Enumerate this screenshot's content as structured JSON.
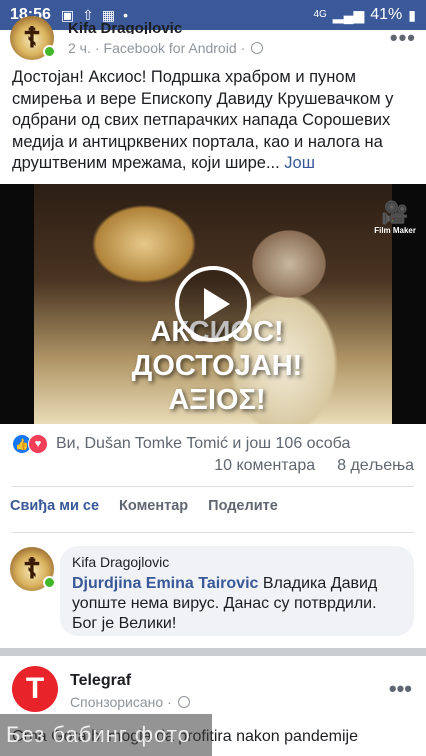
{
  "status_bar": {
    "time": "18:56",
    "icons": [
      "image-icon",
      "upload-icon",
      "calendar-icon",
      "dot-icon"
    ],
    "network": "4G",
    "battery": "41%"
  },
  "post": {
    "author": "Kifa Dragojlovic",
    "time": "2 ч.",
    "source": "Facebook for Android",
    "text": "Достојан! Аксиос! Подршка храбром и пуном смирења и вере Епископу Давиду Крушевачком у одбрани од свих петпарачких напада Сорошевих медија и антицрквених портала, као и налога на друштвеним мрежама, који шире...",
    "see_more": "Још",
    "video": {
      "film_maker": "Film Maker",
      "overlay_lines": [
        "АКСИОС!",
        "ДОСТОЈАН!",
        "ΑΞΙΟΣ!"
      ]
    },
    "reactions_text": "Ви, Dušan Tomke Tomić и још 106 особа",
    "comments_count": "10 коментара",
    "shares_count": "8 дељења",
    "actions": {
      "like": "Свиђа ми се",
      "comment": "Коментар",
      "share": "Поделите"
    }
  },
  "comment": {
    "page": "Kifa Dragojlovic",
    "author": "Djurdjina Emina Tairovic",
    "text": "Владика Давид уопште нема вирус. Данас су потврдили. Бог је Велики!"
  },
  "sponsored": {
    "name": "Telegraf",
    "label": "Спонзорисано",
    "logo_letter": "T",
    "headline": "Crna Gora bi mogla da profitira nakon pandemije",
    "watermark": "Без бабинг фото"
  }
}
